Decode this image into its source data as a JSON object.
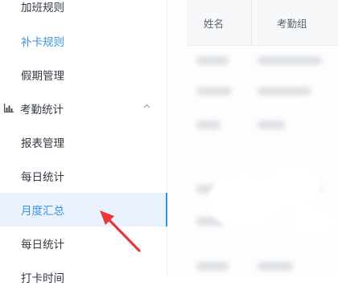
{
  "sidebar": {
    "items": [
      {
        "label": "加班规则"
      },
      {
        "label": "补卡规则"
      },
      {
        "label": "假期管理"
      }
    ],
    "group": {
      "label": "考勤统计",
      "icon": "bar-chart-icon",
      "chevron": "chevron-up-icon",
      "items": [
        {
          "label": "报表管理"
        },
        {
          "label": "每日统计"
        },
        {
          "label": "月度汇总"
        },
        {
          "label": "每日统计"
        },
        {
          "label": "打卡时间"
        }
      ]
    }
  },
  "table": {
    "columns": [
      "姓名",
      "考勤组"
    ]
  },
  "annotation": {
    "icon": "red-arrow-icon",
    "color": "#e8383a"
  },
  "colors": {
    "accent": "#3a93e0",
    "active_bg": "#eaf3fd",
    "text": "#333a44"
  }
}
